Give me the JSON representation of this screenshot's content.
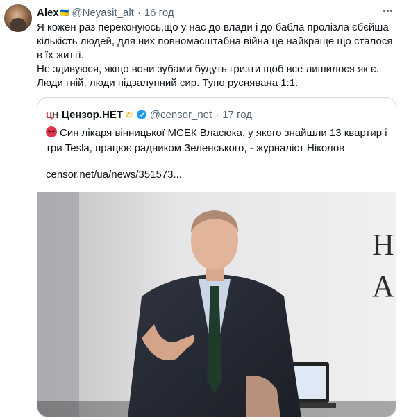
{
  "tweet": {
    "author_name": "Alex",
    "author_emoji": "🇺🇦",
    "handle": "@Neyasit_alt",
    "separator": "·",
    "time": "16 год",
    "more_icon": "more-dots-icon",
    "body_lines": [
      "Я кожен раз переконуюсь,що у нас до влади і до бабла пролізла єбєйша кількість людей, для них повномасштабна війна це найкраще що сталося в їх житті.",
      "Не здивуюся, якщо вони зубами будуть гризти щоб все лишилося як є. Люди гній, люди підзалупний сир. Тупо руснявана 1:1."
    ]
  },
  "quote": {
    "logo_left": "ЦН",
    "author_name": "Цензор.НЕТ",
    "author_emoji": "✍",
    "verified_icon": "verified-badge-icon",
    "handle": "@censor_net",
    "separator": "·",
    "time": "17 год",
    "emoji_icon": "angry-face-icon",
    "text": "Син лікаря вінницької МСЕК Власюка, у якого знайшли 13 квартир і три Tesla, працює радником Зеленського, - журналіст Ніколов",
    "link": "censor.net/ua/news/351573...",
    "image_sign_letters": [
      "Н",
      "А"
    ]
  },
  "colors": {
    "text": "#0f1419",
    "secondary": "#536471",
    "border": "#cfd9de",
    "verified": "#1d9bf0",
    "logo_red": "#c62828"
  }
}
